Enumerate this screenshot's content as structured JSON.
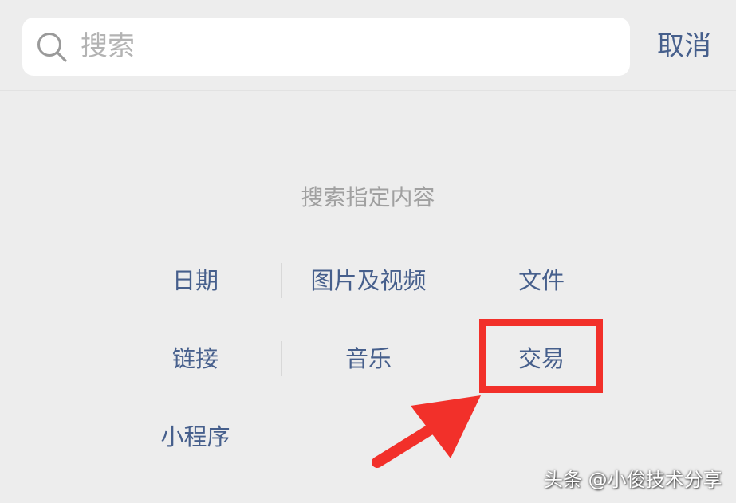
{
  "search": {
    "placeholder": "搜索",
    "cancel_label": "取消"
  },
  "section": {
    "title": "搜索指定内容"
  },
  "options": [
    {
      "label": "日期"
    },
    {
      "label": "图片及视频"
    },
    {
      "label": "文件"
    },
    {
      "label": "链接"
    },
    {
      "label": "音乐"
    },
    {
      "label": "交易"
    },
    {
      "label": "小程序"
    }
  ],
  "annotation": {
    "highlighted_option": "交易",
    "color": "#f2302a",
    "arrow_icon": "arrow-icon"
  },
  "watermark": {
    "text": "头条 @小俊技术分享"
  },
  "colors": {
    "background": "#ededed",
    "accent": "#465f8c",
    "muted_text": "#a0a0a0",
    "placeholder_text": "#b3b3b3"
  }
}
